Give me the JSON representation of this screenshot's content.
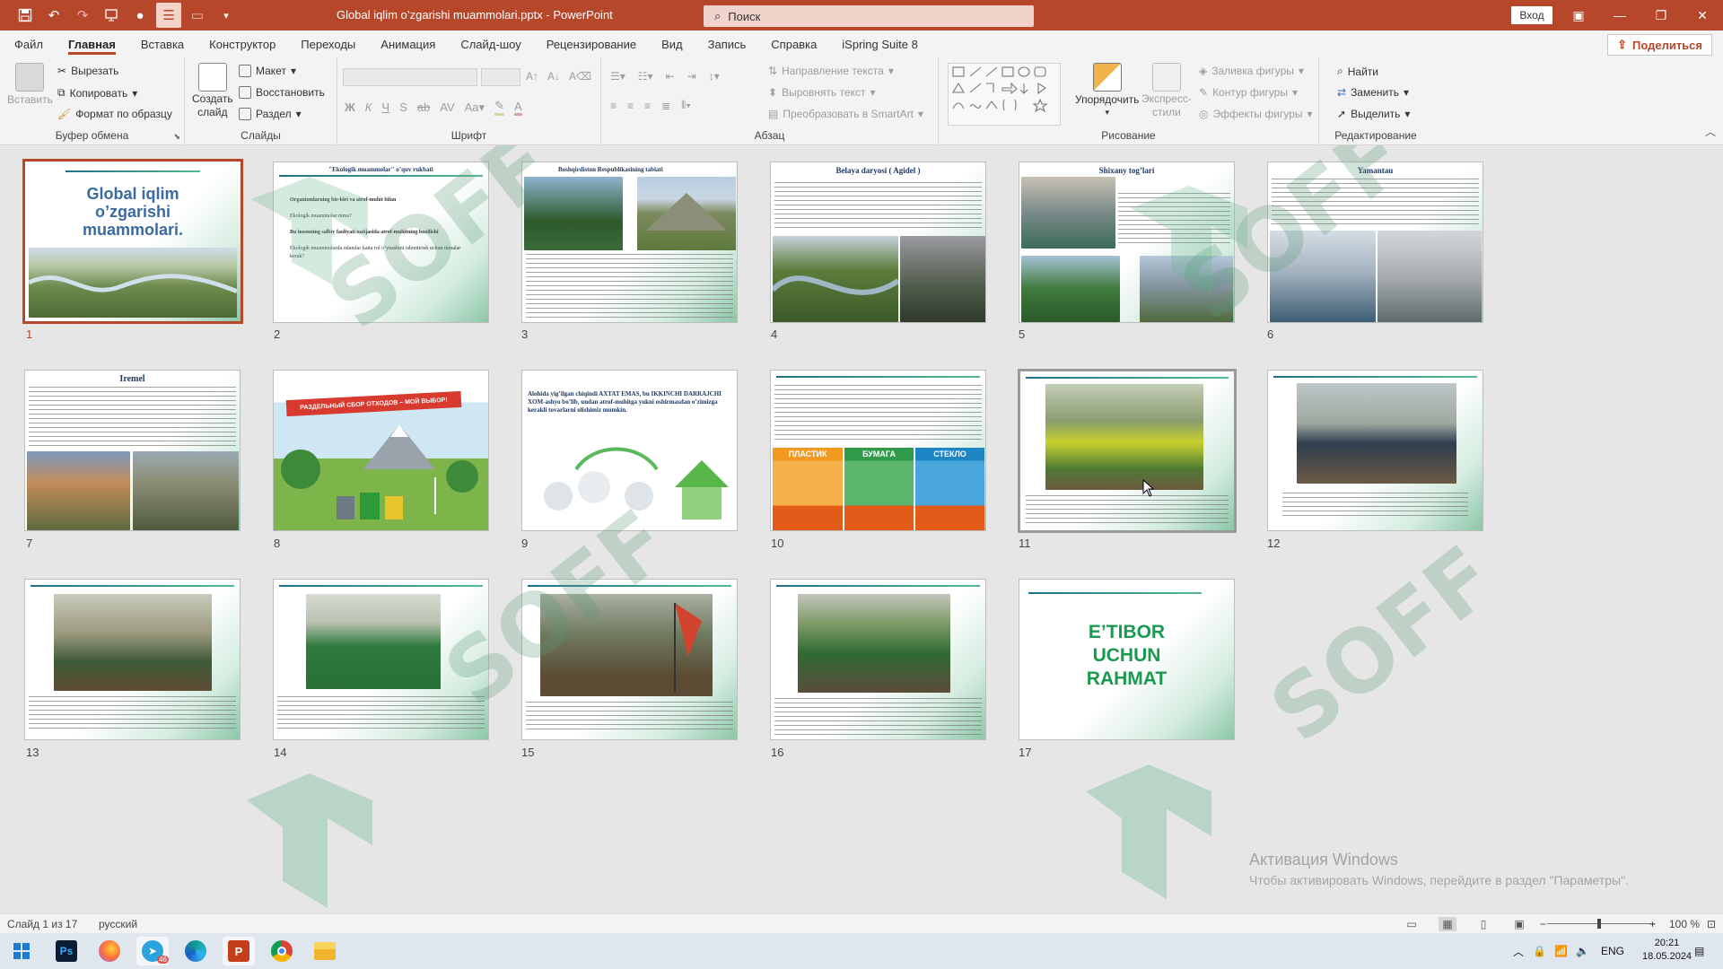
{
  "window": {
    "doc_title": "Global iqlim o’zgarishi muammolari.pptx",
    "app_name": "PowerPoint",
    "title_sep": " - ",
    "search_placeholder": "Поиск",
    "login_label": "Вход"
  },
  "ribbon_tabs": [
    "Файл",
    "Главная",
    "Вставка",
    "Конструктор",
    "Переходы",
    "Анимация",
    "Слайд-шоу",
    "Рецензирование",
    "Вид",
    "Запись",
    "Справка",
    "iSpring Suite 8"
  ],
  "share_label": "Поделиться",
  "ribbon": {
    "clipboard": {
      "label": "Буфер обмена",
      "paste": "Вставить",
      "cut": "Вырезать",
      "copy": "Копировать",
      "format_painter": "Формат по образцу"
    },
    "slides": {
      "label": "Слайды",
      "new_slide_1": "Создать",
      "new_slide_2": "слайд",
      "layout": "Макет",
      "reset": "Восстановить",
      "section": "Раздел"
    },
    "font": {
      "label": "Шрифт"
    },
    "paragraph": {
      "label": "Абзац",
      "text_direction": "Направление текста",
      "align_text": "Выровнять текст",
      "smartart": "Преобразовать в SmartArt"
    },
    "drawing": {
      "label": "Рисование",
      "arrange": "Упорядочить",
      "quick_styles_1": "Экспресс-",
      "quick_styles_2": "стили",
      "fill": "Заливка фигуры",
      "outline": "Контур фигуры",
      "effects": "Эффекты фигуры"
    },
    "editing": {
      "label": "Редактирование",
      "find": "Найти",
      "replace": "Заменить",
      "select": "Выделить"
    }
  },
  "slides": [
    {
      "num": "1",
      "title": "Global iqlim o’zgarishi muammolari."
    },
    {
      "num": "2",
      "title": "\"Ekologik muammolar\" o’quv rukbati",
      "bullets": [
        "Organizmlarning bir-biri va atrof-muhit bilan",
        "Ekologik muammolar nima?",
        "Bu insonning salbiy faoliyati natijasida atrof-muhitning buzilishi",
        "Ekologik muammolarda odamlar katta rol o’ynashini ishontirish uchun nimalar kerak?"
      ]
    },
    {
      "num": "3",
      "title": "Boshqirdiston Respublikasining tabiati"
    },
    {
      "num": "4",
      "title": "Belaya daryosi ( Agidel )"
    },
    {
      "num": "5",
      "title": "Shixany tog’lari"
    },
    {
      "num": "6",
      "title": "Yamantau"
    },
    {
      "num": "7",
      "title": "Iremel"
    },
    {
      "num": "8",
      "title": "",
      "banner": "РАЗДЕЛЬНЫЙ СБОР ОТХОДОВ – МОЙ ВЫБОР!"
    },
    {
      "num": "9",
      "title": "Alohida yig’ilgan chiqindi AXTAT EMAS, bu IKKINCHI DARRAJCHI XOM-ashyo bo’lib, undan atrof-muhitga yukni oshirmasdan o’zimizga kerakli tovarlarni olishimiz mumkin."
    },
    {
      "num": "10",
      "title": "",
      "cats": [
        "ПЛАСТИК",
        "БУМАГА",
        "СТЕКЛО"
      ]
    },
    {
      "num": "11",
      "title": ""
    },
    {
      "num": "12",
      "title": ""
    },
    {
      "num": "13",
      "title": ""
    },
    {
      "num": "14",
      "title": ""
    },
    {
      "num": "15",
      "title": ""
    },
    {
      "num": "16",
      "title": ""
    },
    {
      "num": "17",
      "title": "E’TIBOR UCHUN RAHMAT"
    }
  ],
  "watermark": "SOFF",
  "activation": {
    "line1": "Активация Windows",
    "line2": "Чтобы активировать Windows, перейдите в раздел \"Параметры\"."
  },
  "status": {
    "slide_count": "Слайд 1 из 17",
    "language": "русский",
    "zoom": "100 %"
  },
  "taskbar": {
    "lang": "ENG",
    "time": "20:21",
    "date": "18.05.2024",
    "telegram_badge": "46"
  },
  "colors": {
    "accent": "#b7472a",
    "title_navy": "#1f3864",
    "end_green": "#1a9a50"
  }
}
